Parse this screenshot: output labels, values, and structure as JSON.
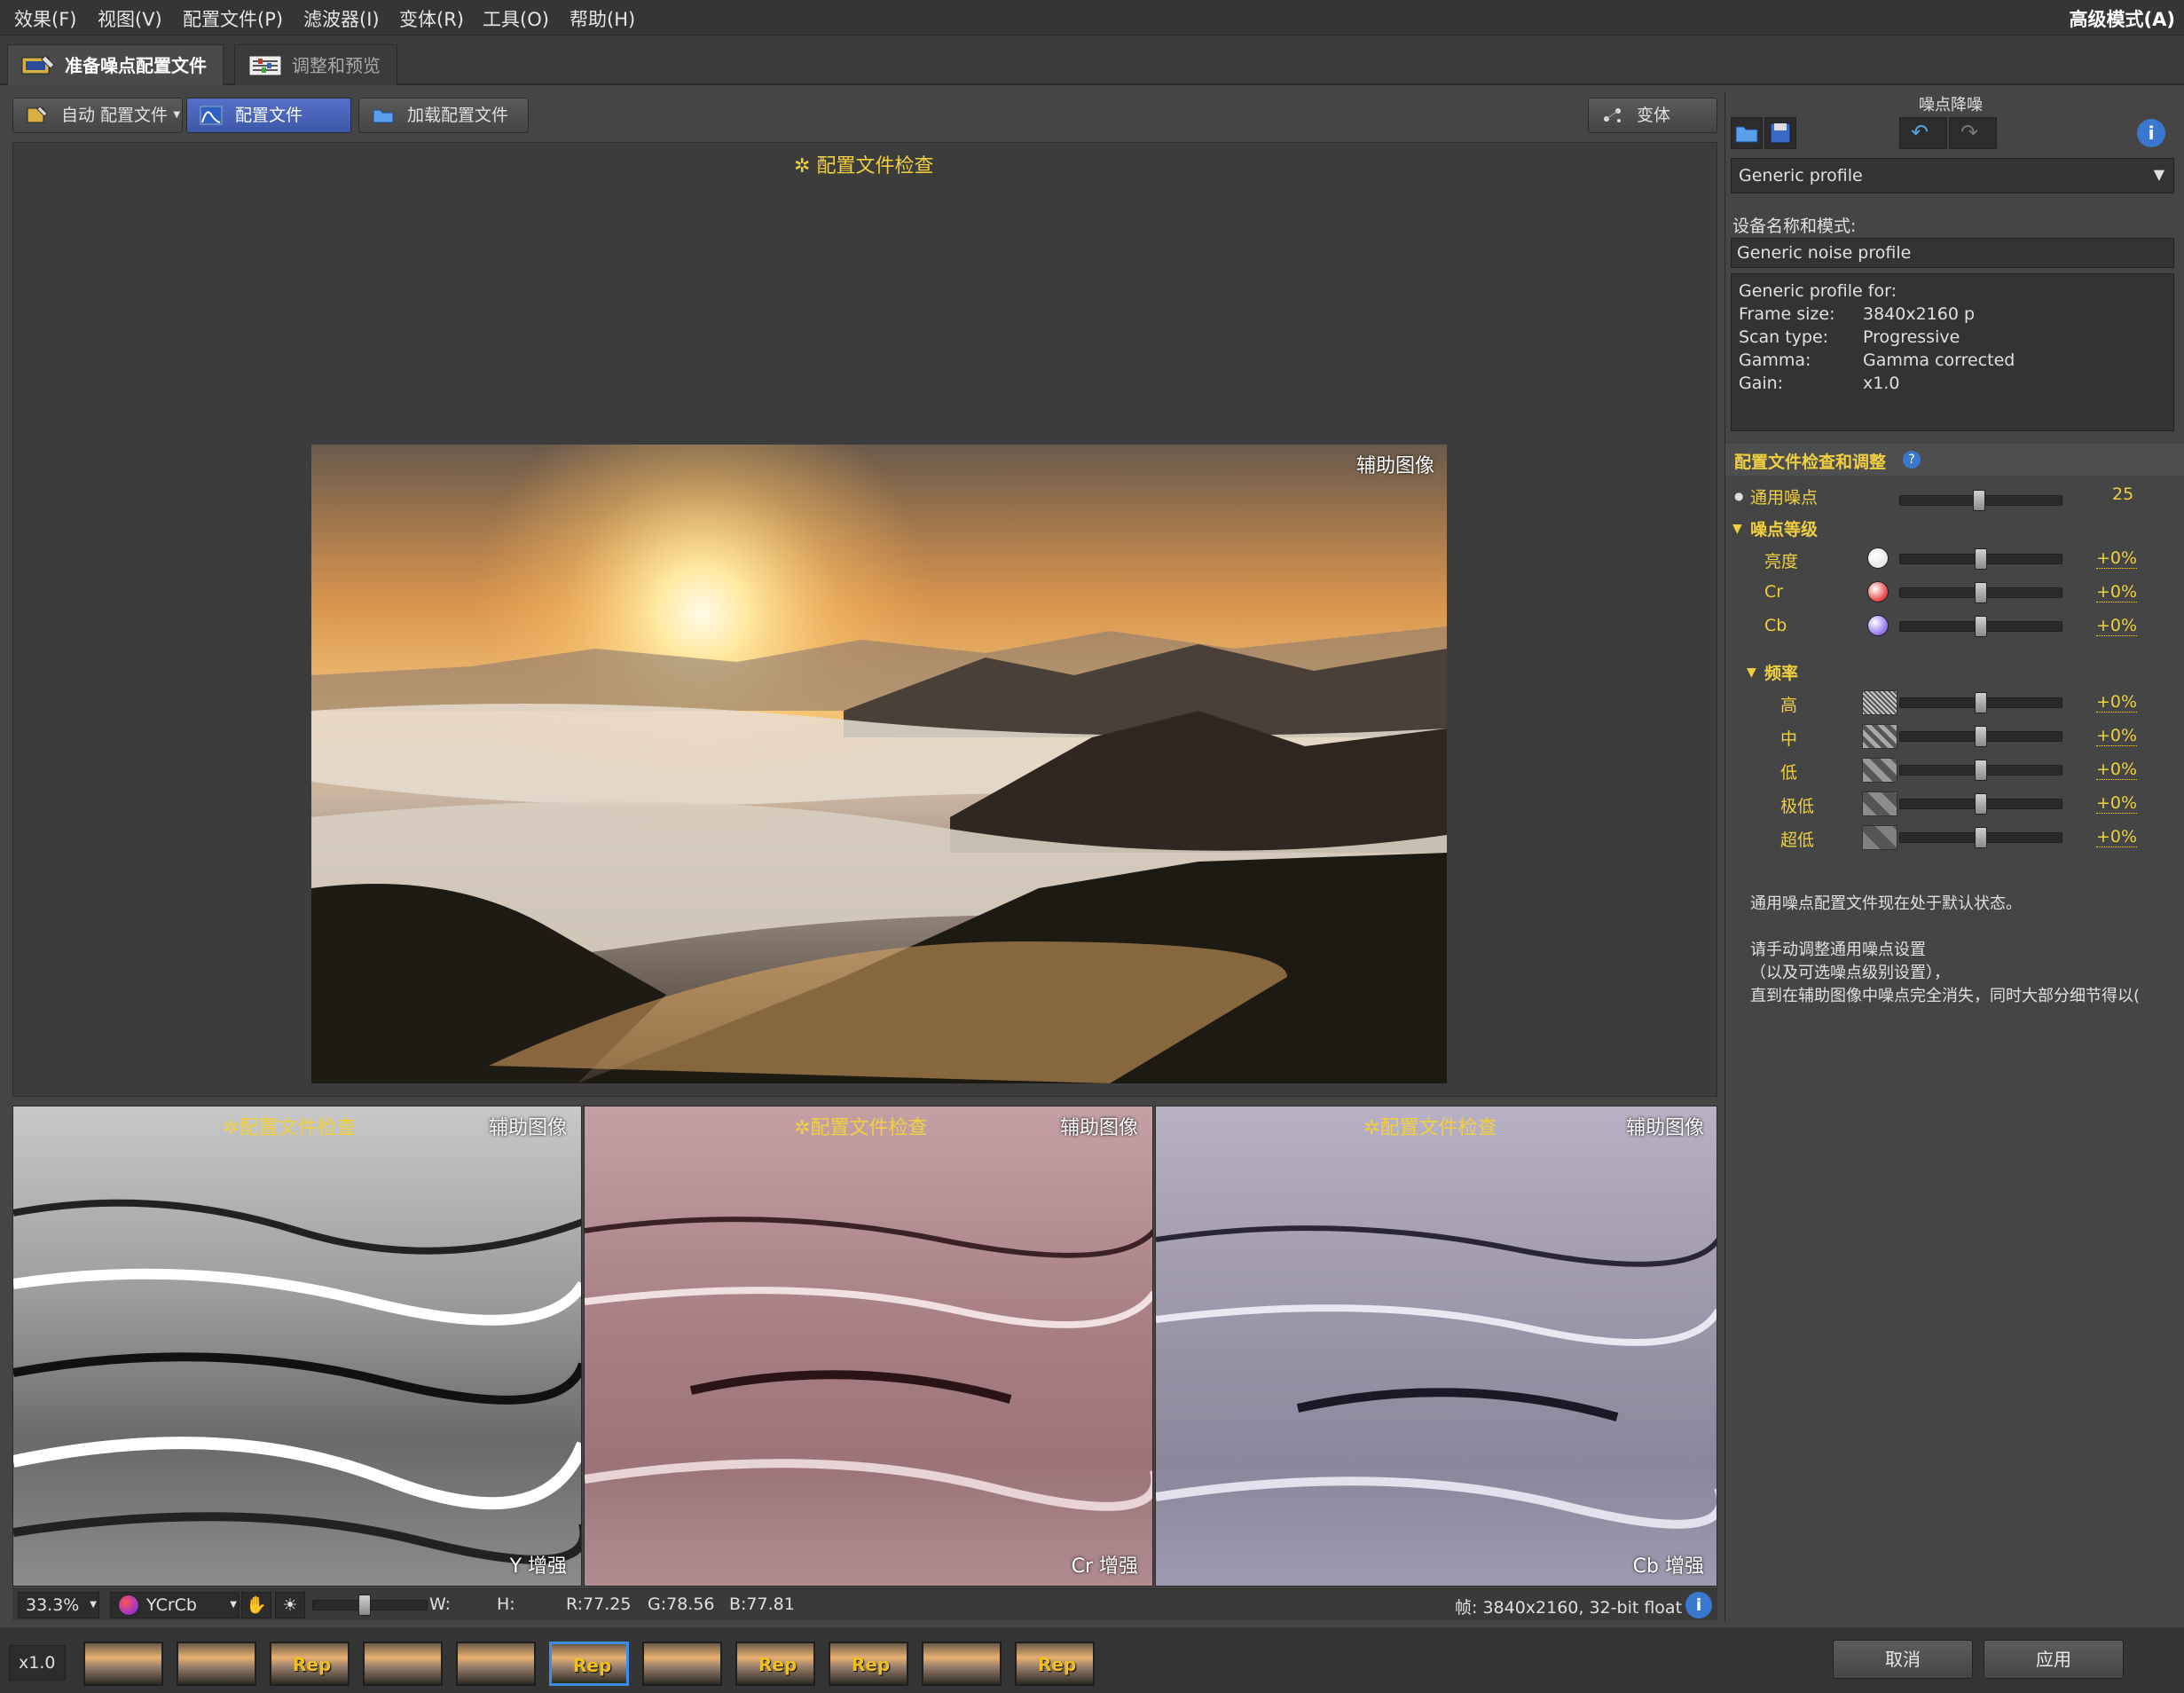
{
  "menu": [
    "效果(F)",
    "视图(V)",
    "配置文件(P)",
    "滤波器(I)",
    "变体(R)",
    "工具(O)",
    "帮助(H)"
  ],
  "mode": "高级模式(A)",
  "tabs": [
    {
      "label": "准备噪点配置文件"
    },
    {
      "label": "调整和预览"
    }
  ],
  "toolbar": {
    "auto_profile": "自动 配置文件",
    "profile": "配置文件",
    "load_profile": "加载配置文件",
    "variant": "变体"
  },
  "viewer": {
    "check_label": "配置文件检查",
    "aux_label": "辅助图像",
    "subviews": [
      {
        "enhance": "Y 增强"
      },
      {
        "enhance": "Cr 增强"
      },
      {
        "enhance": "Cb 增强"
      }
    ]
  },
  "statusbar": {
    "zoom": "33.3%",
    "colorspace": "YCrCb",
    "w_label": "W:",
    "h_label": "H:",
    "r": "R:77.25",
    "g": "G:78.56",
    "b": "B:77.81",
    "frame": "帧: 3840x2160, 32-bit float"
  },
  "filmstrip": {
    "scale": "x1.0",
    "rep_label": "Rep",
    "thumbs": [
      false,
      false,
      true,
      false,
      false,
      true,
      false,
      true,
      true,
      false,
      true
    ]
  },
  "buttons": {
    "cancel": "取消",
    "apply": "应用"
  },
  "panel": {
    "title": "噪点降噪",
    "profile_select": "Generic profile",
    "device_label": "设备名称和模式:",
    "device_value": "Generic noise profile",
    "info_title": "Generic profile for:",
    "info": [
      {
        "k": "Frame size:",
        "v": "3840x2160 p"
      },
      {
        "k": "Scan type:",
        "v": "Progressive"
      },
      {
        "k": "Gamma:",
        "v": "Gamma corrected"
      },
      {
        "k": "Gain:",
        "v": "x1.0"
      }
    ],
    "section_title": "配置文件检查和调整",
    "general_noise": {
      "label": "通用噪点",
      "value": "25",
      "level": 0.49
    },
    "noise_levels": {
      "title": "噪点等级",
      "items": [
        {
          "label": "亮度",
          "value": "+0%",
          "color": "#e8e8e8"
        },
        {
          "label": "Cr",
          "value": "+0%",
          "color": "#e84040"
        },
        {
          "label": "Cb",
          "value": "+0%",
          "color": "#9070f0"
        }
      ]
    },
    "frequency": {
      "title": "频率",
      "items": [
        {
          "label": "高",
          "value": "+0%"
        },
        {
          "label": "中",
          "value": "+0%"
        },
        {
          "label": "低",
          "value": "+0%"
        },
        {
          "label": "极低",
          "value": "+0%"
        },
        {
          "label": "超低",
          "value": "+0%"
        }
      ]
    },
    "note1": "通用噪点配置文件现在处于默认状态。",
    "note2": "请手动调整通用噪点设置",
    "note3": "（以及可选噪点级别设置），",
    "note4": "直到在辅助图像中噪点完全消失，同时大部分细节得以("
  }
}
